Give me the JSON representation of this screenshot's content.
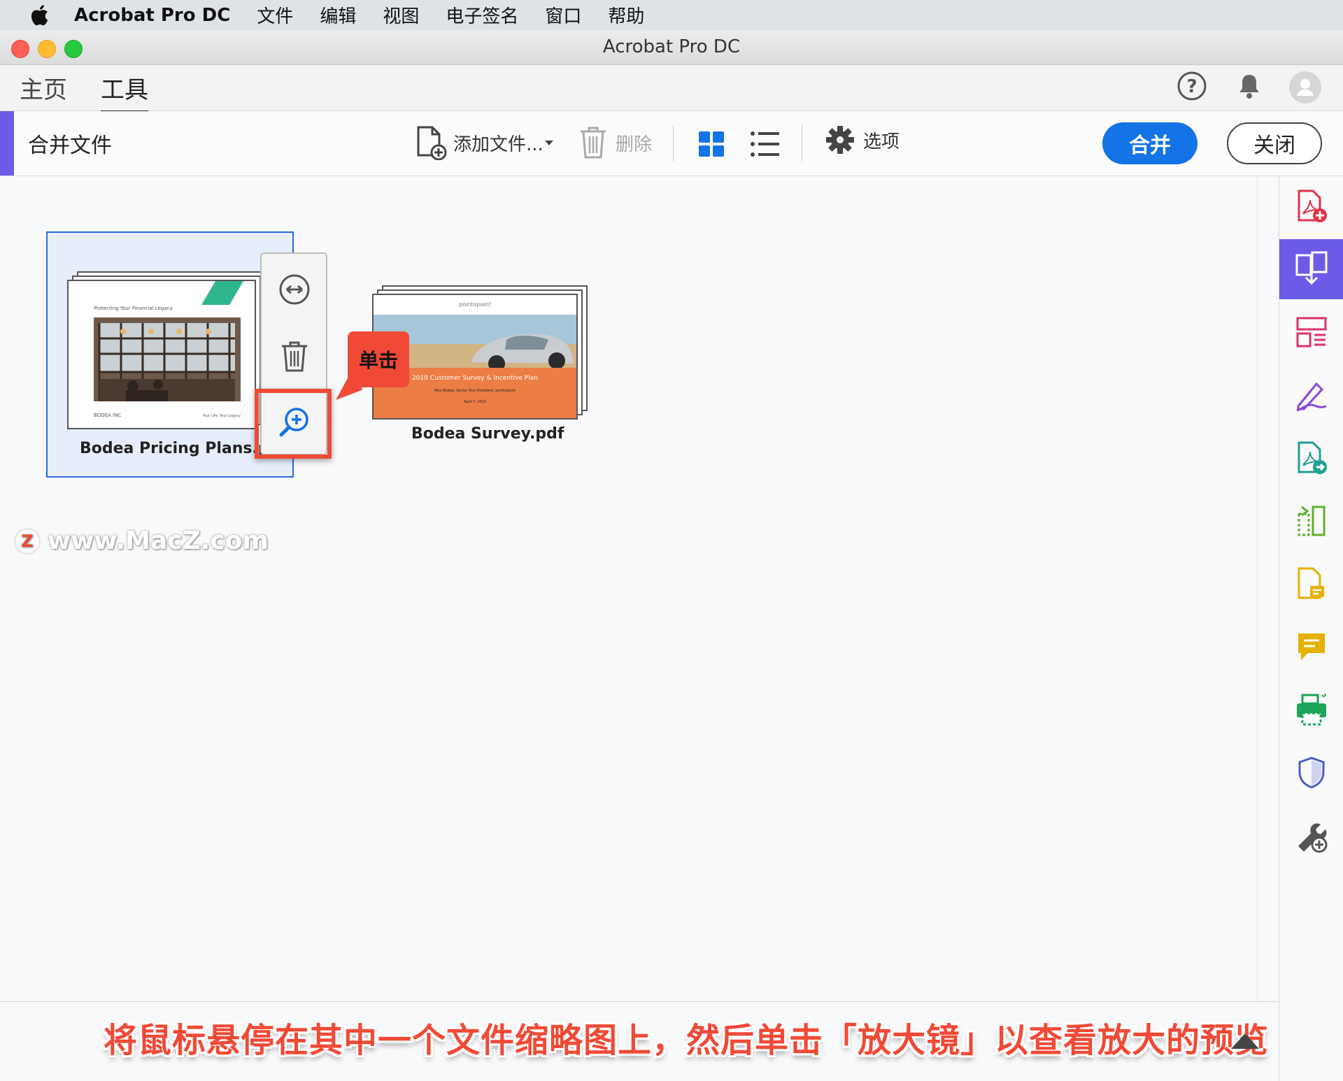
{
  "menubar": {
    "app_name": "Acrobat Pro DC",
    "items": [
      "文件",
      "编辑",
      "视图",
      "电子签名",
      "窗口",
      "帮助"
    ]
  },
  "window": {
    "title": "Acrobat Pro DC"
  },
  "nav": {
    "tabs": [
      {
        "label": "主页",
        "active": false
      },
      {
        "label": "工具",
        "active": true
      }
    ],
    "icons": [
      "help-icon",
      "bell-icon",
      "avatar-icon"
    ]
  },
  "toolbar": {
    "title": "合并文件",
    "add_files_label": "添加文件...",
    "delete_label": "删除",
    "options_label": "选项",
    "combine_label": "合并",
    "close_label": "关闭"
  },
  "files": [
    {
      "name": "Bodea Pricing Plans.pptx",
      "selected": true,
      "slide_title": "Protecting Your Financial Legacy",
      "slide_footer_left": "BODEA INC",
      "slide_footer_right": "Your Life, Your Legacy"
    },
    {
      "name": "Bodea Survey.pdf",
      "selected": false,
      "slide_brand": "pointopoint",
      "slide_title": "2010 Customer Survey & Incentive Plan",
      "slide_subtitle": "Max Bodea, Senior Vice President, pointopoint",
      "slide_date": "April 7, 2010"
    }
  ],
  "hover_panel": {
    "icons": [
      "expand-pages-icon",
      "trash-icon",
      "zoom-in-icon"
    ]
  },
  "callout": {
    "label": "单击"
  },
  "watermark": {
    "logo": "Z",
    "text": "www.MacZ.com"
  },
  "caption": {
    "text": "将鼠标悬停在其中一个文件缩略图上，然后单击「放大镜」以查看放大的预览"
  },
  "colors": {
    "accent_purple": "#6b5ce7",
    "primary_blue": "#1473e6",
    "highlight_red": "#f04a36",
    "selection_blue": "#2d6be0"
  },
  "sidebar": {
    "icons": [
      "create-pdf-icon",
      "combine-files-icon",
      "organize-pages-icon",
      "fill-sign-icon",
      "export-pdf-icon",
      "compress-pdf-icon",
      "edit-pdf-icon",
      "comment-icon",
      "print-production-icon",
      "protect-icon",
      "more-tools-icon"
    ]
  }
}
